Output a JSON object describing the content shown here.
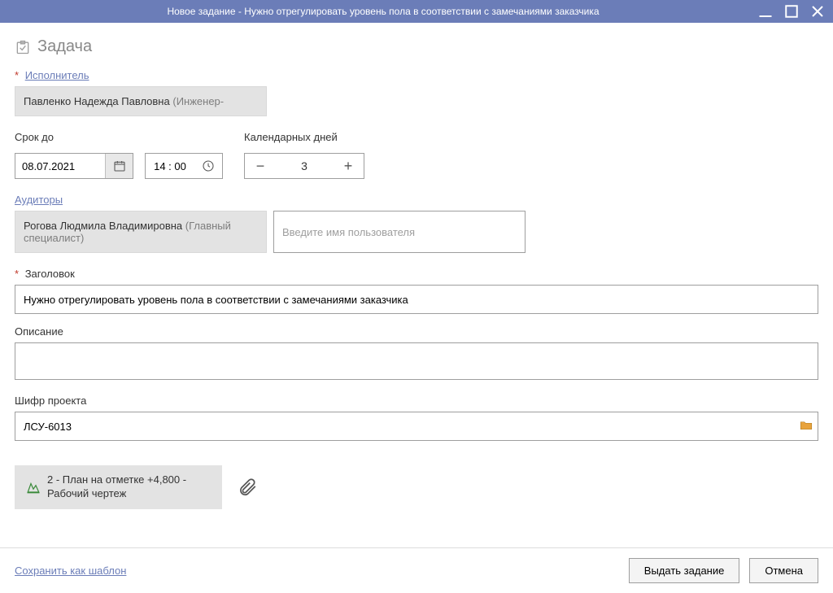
{
  "window": {
    "title": "Новое задание - Нужно отрегулировать уровень пола в соответствии с замечаниями заказчика"
  },
  "header": {
    "label": "Задача"
  },
  "assignee": {
    "label": "Исполнитель",
    "name": "Павленко Надежда Павловна",
    "role": "(Инженер-"
  },
  "deadline": {
    "label": "Срок до",
    "date": "08.07.2021",
    "time": "14 : 00"
  },
  "calendar_days": {
    "label": "Календарных дней",
    "value": "3"
  },
  "auditors": {
    "label": "Аудиторы",
    "chip_name": "Рогова Людмила Владимировна",
    "chip_role": "(Главный специалист)",
    "placeholder": "Введите имя пользователя"
  },
  "title_field": {
    "label": "Заголовок",
    "value": "Нужно отрегулировать уровень пола в соответствии с замечаниями заказчика"
  },
  "description": {
    "label": "Описание",
    "value": ""
  },
  "project_code": {
    "label": "Шифр проекта",
    "value": "ЛСУ-6013"
  },
  "attachment": {
    "label": "2 - План на отметке +4,800 - Рабочий чертеж"
  },
  "footer": {
    "save_template": "Сохранить как шаблон",
    "submit": "Выдать задание",
    "cancel": "Отмена"
  }
}
